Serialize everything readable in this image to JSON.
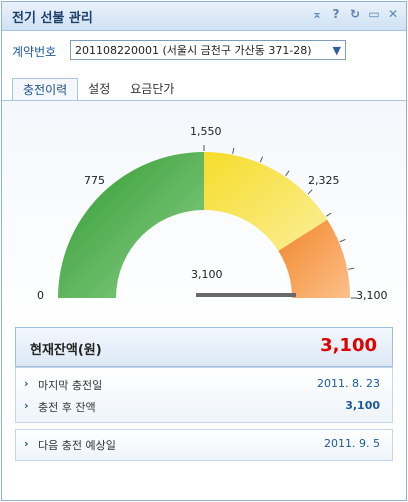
{
  "window": {
    "title": "전기 선불 관리"
  },
  "contract": {
    "label": "계약번호",
    "selected": "201108220001 (서울시 금천구 가산동 371-28)"
  },
  "tabs": [
    {
      "label": "충전이력"
    },
    {
      "label": "설정"
    },
    {
      "label": "요금단가"
    }
  ],
  "gauge": {
    "min_label": "0",
    "q1_label": "775",
    "mid_label": "1,550",
    "q3_label": "2,325",
    "max_label": "3,100",
    "needle_value_label": "3,100",
    "min": 0,
    "max": 3100,
    "value": 3100,
    "colors": {
      "green": "#3aa83a",
      "yellow": "#f0d020",
      "orange": "#f07a1e"
    }
  },
  "balance": {
    "label": "현재잔액(원)",
    "value": "3,100"
  },
  "details": {
    "last_charge_label": "마지막 충전일",
    "last_charge_value": "2011. 8. 23",
    "after_charge_label": "충전 후 잔액",
    "after_charge_value": "3,100",
    "next_charge_label": "다음 충전 예상일",
    "next_charge_value": "2011. 9. 5"
  }
}
